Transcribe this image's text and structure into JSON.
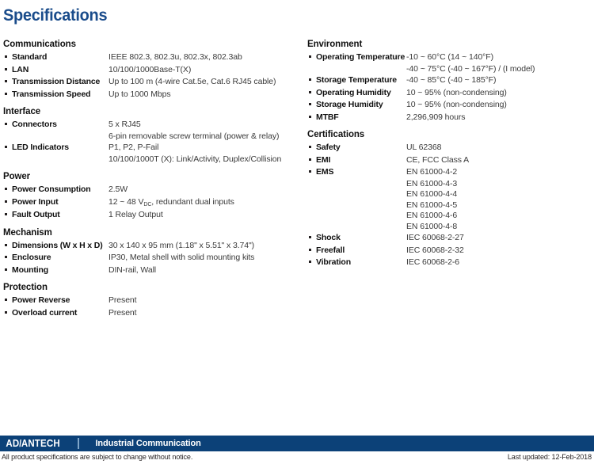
{
  "page": {
    "title": "Specifications"
  },
  "left_column": [
    {
      "heading": "Communications",
      "rows": [
        {
          "label": "Standard",
          "values": [
            "IEEE 802.3, 802.3u, 802.3x, 802.3ab"
          ]
        },
        {
          "label": "LAN",
          "values": [
            "10/100/1000Base-T(X)"
          ]
        },
        {
          "label": "Transmission Distance",
          "values": [
            "Up to 100 m (4-wire Cat.5e, Cat.6 RJ45 cable)"
          ]
        },
        {
          "label": "Transmission Speed",
          "values": [
            "Up to 1000 Mbps"
          ]
        }
      ]
    },
    {
      "heading": "Interface",
      "rows": [
        {
          "label": "Connectors",
          "values": [
            "5 x RJ45",
            "6-pin removable screw terminal (power & relay)"
          ]
        },
        {
          "label": "LED Indicators",
          "values": [
            "P1, P2, P-Fail",
            "10/100/1000T (X): Link/Activity, Duplex/Collision"
          ]
        }
      ]
    },
    {
      "heading": "Power",
      "rows": [
        {
          "label": "Power Consumption",
          "values": [
            "2.5W"
          ]
        },
        {
          "label": "Power Input",
          "values_html": [
            "12 ~ 48 V<sub>DC</sub>, redundant dual inputs"
          ]
        },
        {
          "label": "Fault Output",
          "values": [
            "1 Relay Output"
          ]
        }
      ]
    },
    {
      "heading": "Mechanism",
      "rows": [
        {
          "label": "Dimensions (W x H x D)",
          "values": [
            "30 x 140 x 95 mm (1.18\" x 5.51\" x 3.74\")"
          ]
        },
        {
          "label": "Enclosure",
          "values": [
            "IP30, Metal shell with solid mounting kits"
          ]
        },
        {
          "label": "Mounting",
          "values": [
            "DIN-rail, Wall"
          ]
        }
      ]
    },
    {
      "heading": "Protection",
      "rows": [
        {
          "label": "Power Reverse",
          "values": [
            "Present"
          ]
        },
        {
          "label": "Overload current",
          "values": [
            "Present"
          ]
        }
      ]
    }
  ],
  "right_column": [
    {
      "heading": "Environment",
      "rows": [
        {
          "label": "Operating Temperature",
          "values": [
            "-10 ~ 60°C (14 ~ 140°F)",
            "-40 ~ 75°C (-40 ~ 167°F) / (I model)"
          ]
        },
        {
          "label": "Storage Temperature",
          "values": [
            "-40 ~ 85°C (-40 ~ 185°F)"
          ]
        },
        {
          "label": "Operating Humidity",
          "values": [
            "10 ~ 95% (non-condensing)"
          ]
        },
        {
          "label": "Storage Humidity",
          "values": [
            "10 ~ 95% (non-condensing)"
          ]
        },
        {
          "label": "MTBF",
          "values": [
            "2,296,909 hours"
          ]
        }
      ]
    },
    {
      "heading": "Certifications",
      "rows": [
        {
          "label": "Safety",
          "values": [
            "UL 62368"
          ]
        },
        {
          "label": "EMI",
          "values": [
            "CE, FCC Class A"
          ]
        },
        {
          "label": "EMS",
          "values": [
            "EN 61000-4-2",
            "EN 61000-4-3",
            "EN 61000-4-4",
            "EN 61000-4-5",
            "EN 61000-4-6",
            "EN 61000-4-8"
          ]
        },
        {
          "label": "Shock",
          "values": [
            "IEC 60068-2-27"
          ]
        },
        {
          "label": "Freefall",
          "values": [
            "IEC 60068-2-32"
          ]
        },
        {
          "label": "Vibration",
          "values": [
            "IEC 60068-2-6"
          ]
        }
      ]
    }
  ],
  "footer": {
    "logo_pre": "AD",
    "logo_slash": "\\",
    "logo_post": "ANTECH",
    "tagline": "Industrial Communication",
    "note": "All product specifications are subject to change without notice.",
    "updated": "Last updated: 12-Feb-2018",
    "bar_color": "#0c4178"
  }
}
